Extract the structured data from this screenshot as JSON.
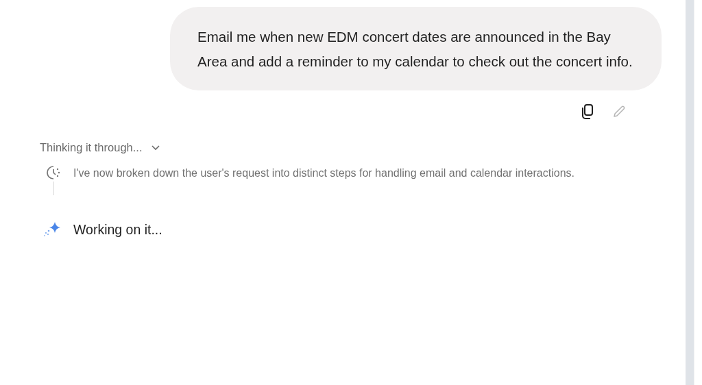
{
  "user_message": {
    "text": "Email me when new EDM concert dates are announced in the Bay Area and add a reminder to my calendar to check out the concert info."
  },
  "thinking": {
    "label": "Thinking it through...",
    "expanded": false,
    "step": "I've now broken down the user's request into distinct steps for handling email and calendar interactions."
  },
  "status": {
    "text": "Working on it..."
  }
}
